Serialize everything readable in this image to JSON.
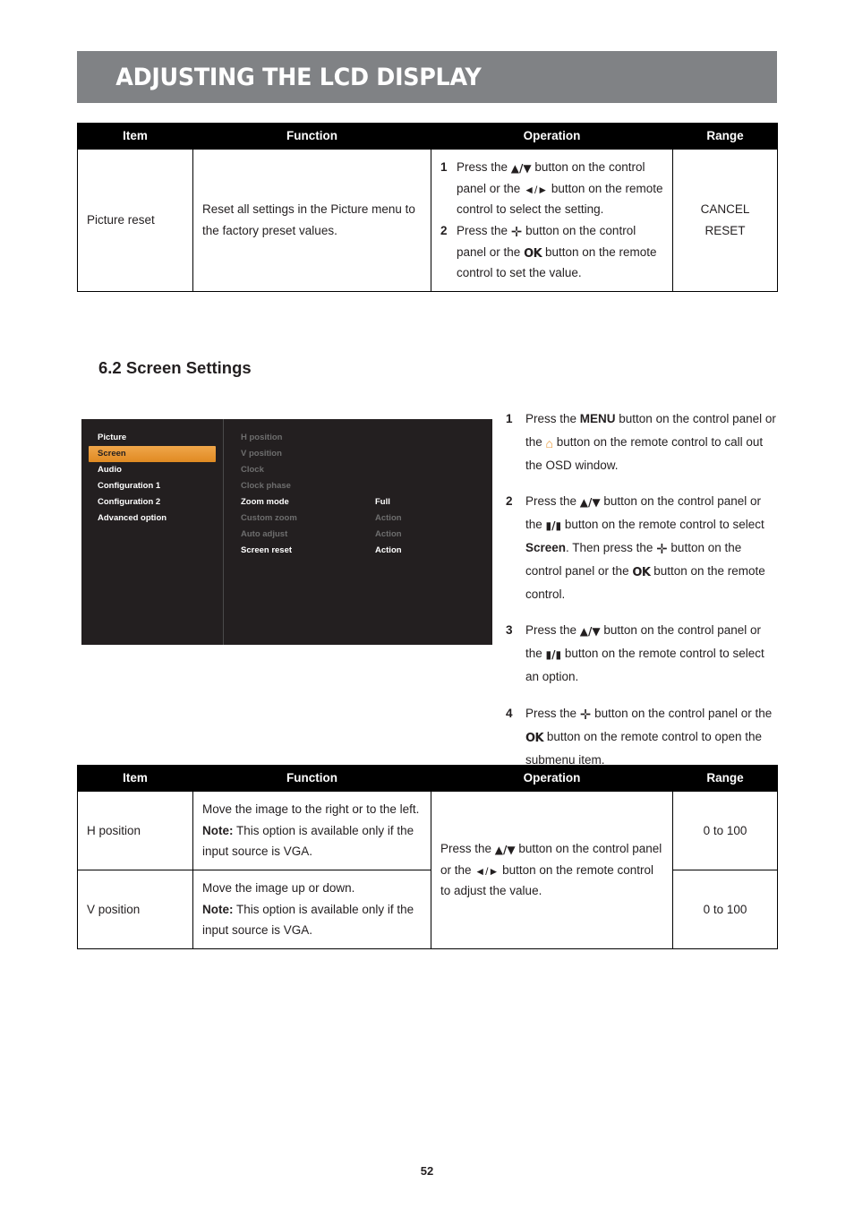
{
  "header": {
    "title": "Adjusting the LCD Display"
  },
  "table_picture_reset": {
    "headers": [
      "Item",
      "Function",
      "Operation",
      "Range"
    ],
    "row": {
      "item": "Picture reset",
      "function": "Reset all settings in the Picture menu to the factory preset values.",
      "operation": [
        {
          "num": "1",
          "parts_before": "Press the ",
          "parts_mid": " button on the control panel or the ",
          "parts_after": " button on the remote control to select the setting."
        },
        {
          "num": "2",
          "parts_before": "Press the ",
          "parts_mid": " button on the control panel or the ",
          "parts_after": " button on the remote control to set the value."
        }
      ],
      "range_line1": "CANCEL",
      "range_line2": "RESET"
    }
  },
  "section": {
    "heading": "6.2 Screen Settings"
  },
  "osd": {
    "menu_items": [
      {
        "label": "Picture",
        "selected": false
      },
      {
        "label": "Screen",
        "selected": true
      },
      {
        "label": "Audio",
        "selected": false
      },
      {
        "label": "Configuration 1",
        "selected": false
      },
      {
        "label": "Configuration 2",
        "selected": false
      },
      {
        "label": "Advanced option",
        "selected": false
      }
    ],
    "options": [
      {
        "label": "H position",
        "value": "",
        "state": "dim"
      },
      {
        "label": "V position",
        "value": "",
        "state": "dim"
      },
      {
        "label": "Clock",
        "value": "",
        "state": "dim"
      },
      {
        "label": "Clock phase",
        "value": "",
        "state": "dim"
      },
      {
        "label": "Zoom mode",
        "value": "Full",
        "state": "bright"
      },
      {
        "label": "Custom zoom",
        "value": "Action",
        "state": "dim"
      },
      {
        "label": "Auto adjust",
        "value": "Action",
        "state": "dim"
      },
      {
        "label": "Screen reset",
        "value": "Action",
        "state": "bright"
      }
    ]
  },
  "steps": [
    {
      "num": "1",
      "a": "Press the ",
      "menu": "MENU",
      "b": " button on the control panel or the ",
      "c": " button on the remote control to call out the OSD window."
    },
    {
      "num": "2",
      "a": "Press the ",
      "b": " button on the control panel or the ",
      "c": " button on the remote control to select ",
      "screen": "Screen",
      "d": ". Then press the ",
      "e": " button on the control panel or the ",
      "f": " button on the remote control."
    },
    {
      "num": "3",
      "a": "Press the ",
      "b": " button on the control panel or the ",
      "c": " button on the remote control to select an option."
    },
    {
      "num": "4",
      "a": "Press the ",
      "b": " button on the control panel or the ",
      "c": " button on the remote control to open the submenu item."
    }
  ],
  "table_screen_pos": {
    "headers": [
      "Item",
      "Function",
      "Operation",
      "Range"
    ],
    "rows": [
      {
        "item": "H position",
        "function_main": "Move the image to the right or to the left.",
        "note_label": "Note:",
        "note_text": " This option is available only if the input source is VGA.",
        "range": "0 to 100"
      },
      {
        "item": "V position",
        "function_main": "Move the image up or down.",
        "note_label": "Note:",
        "note_text": " This option is available only if the input source is VGA.",
        "range": "0 to 100"
      }
    ],
    "operation": {
      "a": "Press the ",
      "b": " button on the control panel or the ",
      "c": " button on the remote control to adjust the value."
    }
  },
  "footer": {
    "page_number": "52"
  },
  "icons": {
    "up": "▲",
    "down": "▼",
    "slash": "/",
    "ok": "OK",
    "plus": "✚",
    "minus_plus": "▬/▬",
    "home": "⌂",
    "up_down_remote": "▮/▮"
  },
  "colors": {
    "banner": "#808285",
    "header_row": "#000000",
    "osd_bg": "#231f20",
    "osd_highlight": "#e8922a",
    "text": "#231f20"
  }
}
